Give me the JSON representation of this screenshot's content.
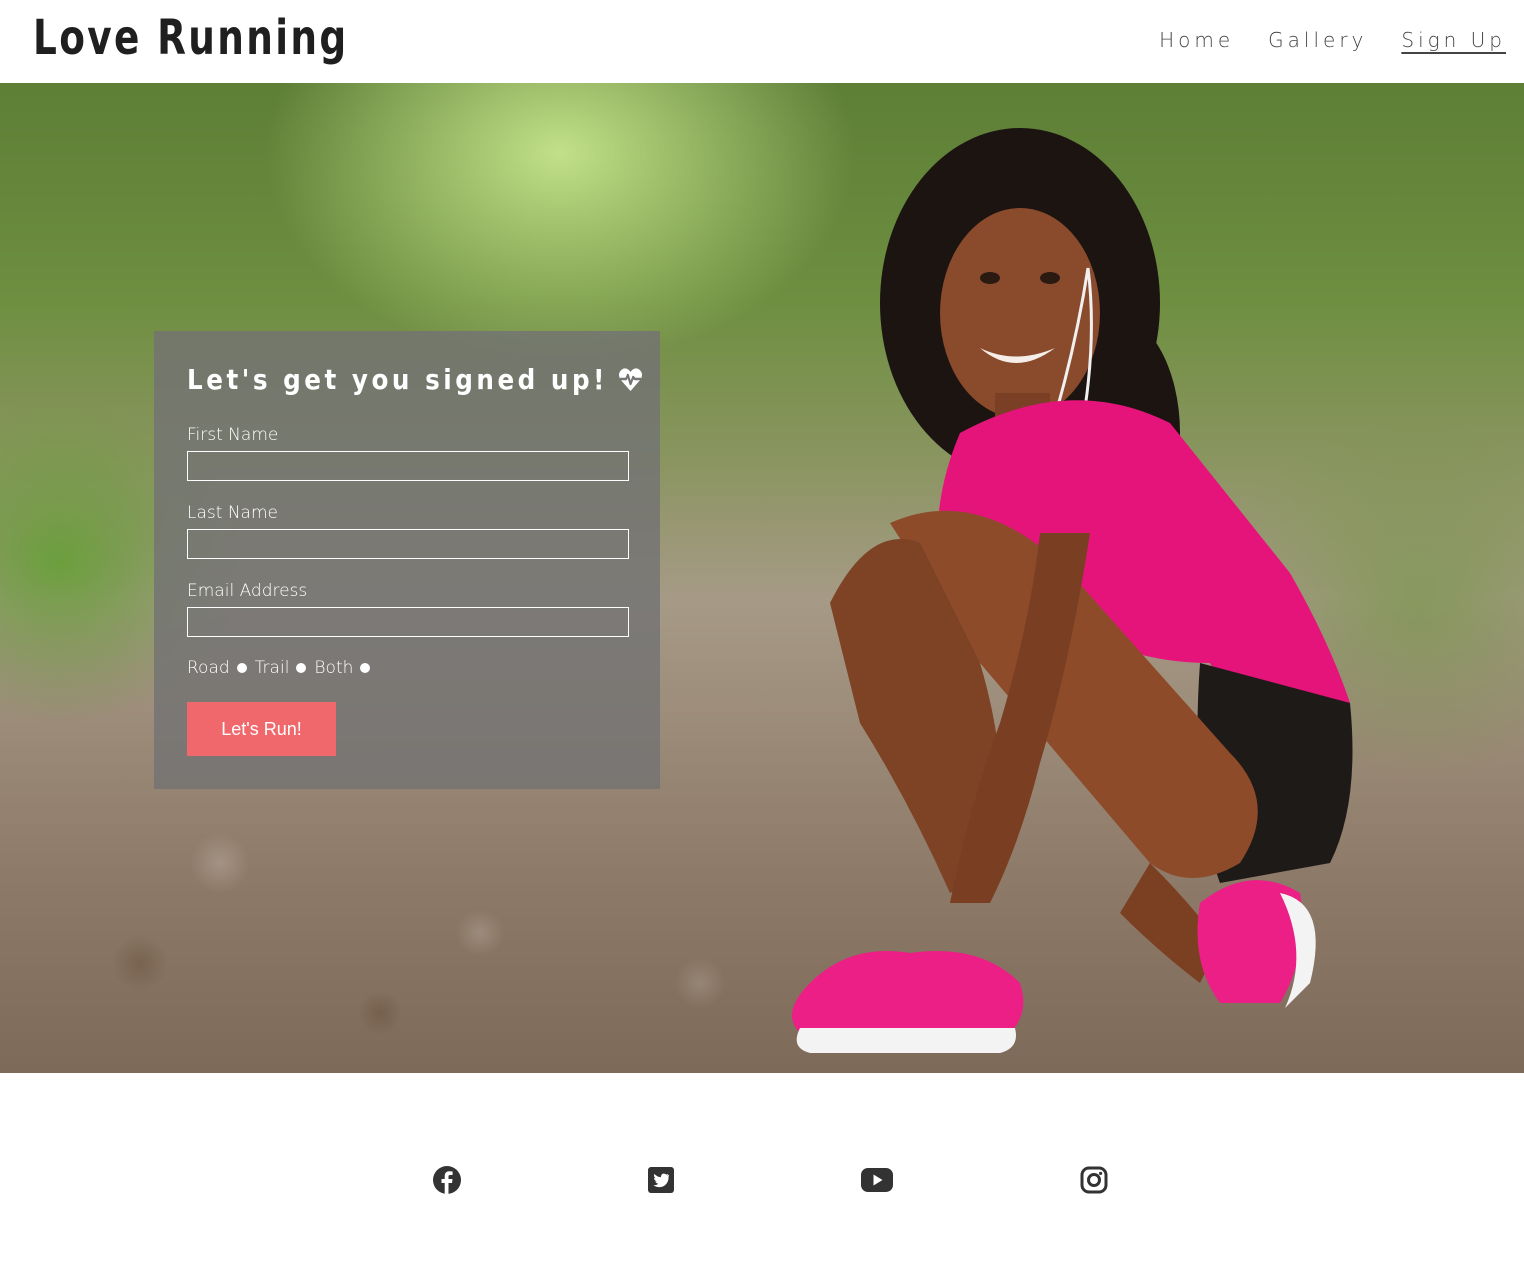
{
  "header": {
    "logo": "Love Running",
    "nav": [
      {
        "label": "Home"
      },
      {
        "label": "Gallery"
      },
      {
        "label": "Sign Up"
      }
    ]
  },
  "form": {
    "title": "Let's get you signed up!",
    "title_icon": "heartbeat-icon",
    "fields": [
      {
        "label": "First Name",
        "value": "",
        "placeholder": ""
      },
      {
        "label": "Last Name",
        "value": "",
        "placeholder": ""
      },
      {
        "label": "Email Address",
        "value": "",
        "placeholder": ""
      }
    ],
    "options": [
      {
        "label": "Road"
      },
      {
        "label": "Trail"
      },
      {
        "label": "Both"
      }
    ],
    "submit_label": "Let's Run!"
  },
  "footer": {
    "icons": [
      "facebook-icon",
      "twitter-icon",
      "youtube-icon",
      "instagram-icon"
    ]
  },
  "colors": {
    "accent": "#f0686c",
    "panel": "#737373",
    "text_dark": "#1f1f1f"
  }
}
